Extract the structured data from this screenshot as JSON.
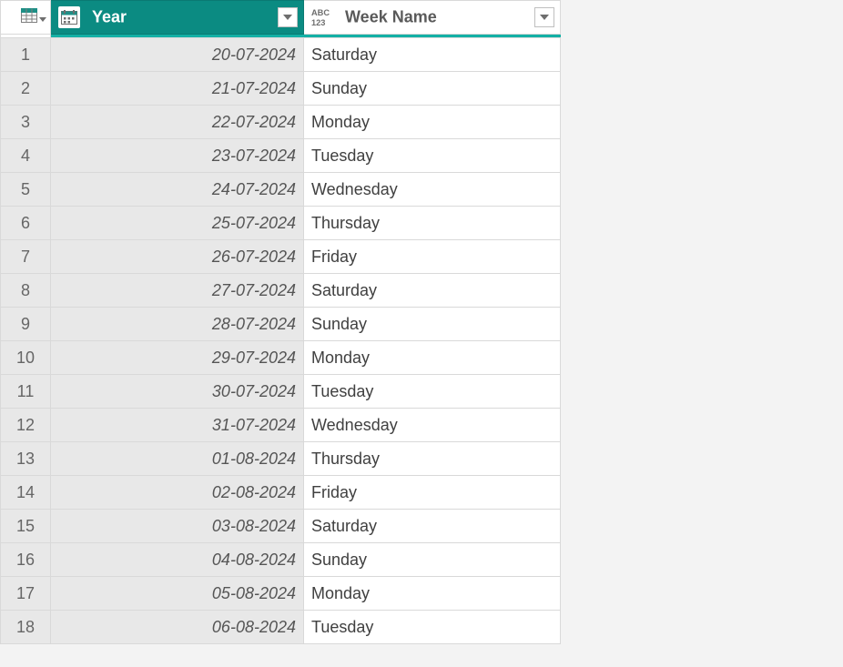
{
  "columns": {
    "row_header_icon": "table-icon",
    "year": {
      "label": "Year",
      "type_icon": "calendar-icon"
    },
    "week": {
      "label": "Week Name",
      "type_icon": "abc123-icon"
    }
  },
  "rows": [
    {
      "n": "1",
      "year": "20-07-2024",
      "week": "Saturday"
    },
    {
      "n": "2",
      "year": "21-07-2024",
      "week": "Sunday"
    },
    {
      "n": "3",
      "year": "22-07-2024",
      "week": "Monday"
    },
    {
      "n": "4",
      "year": "23-07-2024",
      "week": "Tuesday"
    },
    {
      "n": "5",
      "year": "24-07-2024",
      "week": "Wednesday"
    },
    {
      "n": "6",
      "year": "25-07-2024",
      "week": "Thursday"
    },
    {
      "n": "7",
      "year": "26-07-2024",
      "week": "Friday"
    },
    {
      "n": "8",
      "year": "27-07-2024",
      "week": "Saturday"
    },
    {
      "n": "9",
      "year": "28-07-2024",
      "week": "Sunday"
    },
    {
      "n": "10",
      "year": "29-07-2024",
      "week": "Monday"
    },
    {
      "n": "11",
      "year": "30-07-2024",
      "week": "Tuesday"
    },
    {
      "n": "12",
      "year": "31-07-2024",
      "week": "Wednesday"
    },
    {
      "n": "13",
      "year": "01-08-2024",
      "week": "Thursday"
    },
    {
      "n": "14",
      "year": "02-08-2024",
      "week": "Friday"
    },
    {
      "n": "15",
      "year": "03-08-2024",
      "week": "Saturday"
    },
    {
      "n": "16",
      "year": "04-08-2024",
      "week": "Sunday"
    },
    {
      "n": "17",
      "year": "05-08-2024",
      "week": "Monday"
    },
    {
      "n": "18",
      "year": "06-08-2024",
      "week": "Tuesday"
    }
  ]
}
